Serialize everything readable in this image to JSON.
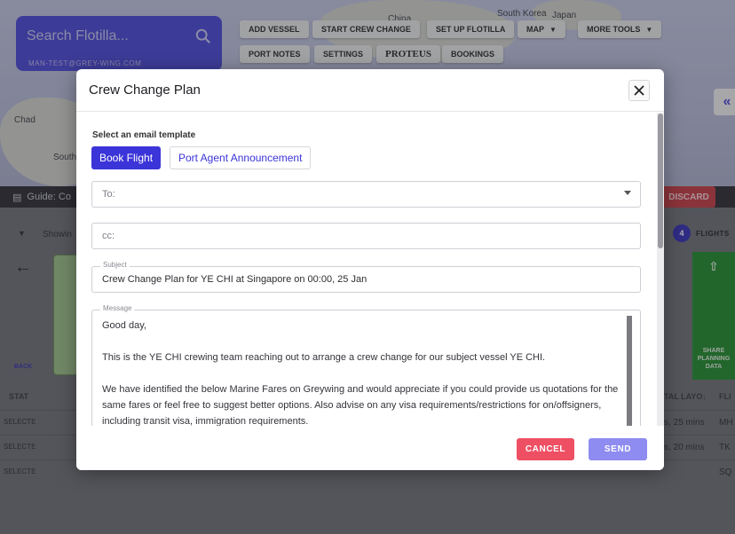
{
  "background": {
    "search": {
      "placeholder": "Search Flotilla...",
      "subtext": "MAN-TEST@GREY-WING.COM"
    },
    "toolbar": {
      "add_vessel": "ADD VESSEL",
      "start_crew_change": "START CREW CHANGE",
      "set_up_flotilla": "SET UP FLOTILLA",
      "map": "MAP",
      "more_tools": "MORE TOOLS",
      "port_notes": "PORT NOTES",
      "settings": "SETTINGS",
      "proteus": "PROTEUS",
      "bookings": "BOOKINGS"
    },
    "map_labels": {
      "china": "China",
      "south_korea": "South Korea",
      "japan": "Japan",
      "chad": "Chad",
      "south": "South"
    },
    "guide_text": "Guide: Co",
    "discard": "DISCARD",
    "showing_text": "Showin",
    "flights_count": "4",
    "flights_label": "FLIGHTS",
    "back_label": "BACK",
    "share_label": "SHARE PLANNING DATA",
    "table_headers": {
      "status": "STAT",
      "total_layover": "TAL LAYO↓",
      "flight": "FLI"
    },
    "rows": [
      {
        "status": "SELECTE",
        "layover": "s, 25 mins",
        "flight": "MH"
      },
      {
        "status": "SELECTE",
        "layover": "s, 20 mins",
        "flight": "TK"
      },
      {
        "status": "SELECTE",
        "layover": "",
        "flight": "SQ"
      }
    ]
  },
  "modal": {
    "title": "Crew Change Plan",
    "template_label": "Select an email template",
    "templates": [
      "Book Flight",
      "Port Agent Announcement"
    ],
    "to_placeholder": "To:",
    "cc_placeholder": "cc:",
    "subject_label": "Subject",
    "subject_value": "Crew Change Plan for YE CHI at Singapore on 00:00, 25 Jan",
    "message_label": "Message",
    "message_paragraphs": [
      "Good day,",
      "This is the YE CHI crewing team reaching out to arrange a crew change for our subject vessel YE CHI.",
      "We have identified the below Marine Fares on Greywing and would appreciate if you could provide us quotations for the same fares or feel free to suggest better options. Also advise on any visa requirements/restrictions for on/offsigners, including transit visa, immigration requirements."
    ],
    "cancel": "CANCEL",
    "send": "SEND"
  },
  "colors": {
    "accent": "#3b34d8",
    "cancel": "#ee4f63",
    "send": "#8e8cf0"
  }
}
